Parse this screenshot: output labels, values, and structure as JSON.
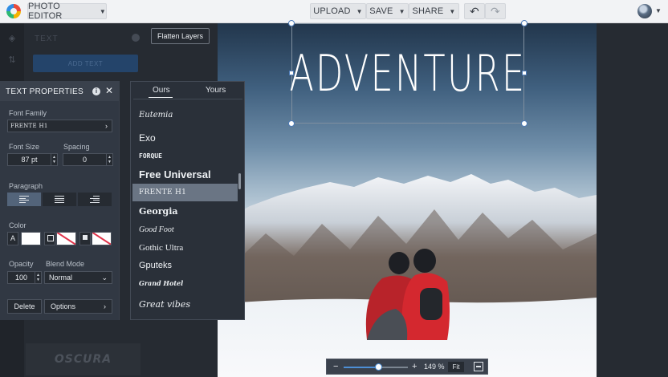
{
  "app": {
    "menu_label": "PHOTO EDITOR",
    "icon": "app-logo-icon"
  },
  "toolbar": {
    "upload_label": "UPLOAD",
    "save_label": "SAVE",
    "share_label": "SHARE",
    "undo_icon": "undo-icon",
    "redo_icon": "redo-icon"
  },
  "background_panel": {
    "title": "TEXT",
    "add_text_label": "ADD TEXT",
    "preview_font_label": "OSCURA"
  },
  "flatten_label": "Flatten Layers",
  "text_properties": {
    "title": "TEXT PROPERTIES",
    "font_family_label": "Font Family",
    "font_family_value": "FRENTE H1",
    "font_size_label": "Font Size",
    "font_size_value": "87 pt",
    "spacing_label": "Spacing",
    "spacing_value": "0",
    "paragraph_label": "Paragraph",
    "paragraph_selected": "left",
    "color_label": "Color",
    "text_color_label": "A",
    "text_color": "#ffffff",
    "opacity_label": "Opacity",
    "opacity_value": "100",
    "blend_label": "Blend Mode",
    "blend_value": "Normal",
    "delete_label": "Delete",
    "options_label": "Options"
  },
  "font_picker": {
    "tabs": [
      "Ours",
      "Yours"
    ],
    "active_tab": "Ours",
    "fonts": [
      {
        "name": "Eutemia",
        "selected": false
      },
      {
        "name": "Exo",
        "selected": false
      },
      {
        "name": "FORQUE",
        "selected": false
      },
      {
        "name": "Free Universal",
        "selected": false
      },
      {
        "name": "FRENTE H1",
        "selected": true
      },
      {
        "name": "Georgia",
        "selected": false
      },
      {
        "name": "Good Foot",
        "selected": false
      },
      {
        "name": "Gothic Ultra",
        "selected": false
      },
      {
        "name": "Gputeks",
        "selected": false
      },
      {
        "name": "Grand Hotel",
        "selected": false
      },
      {
        "name": "Great vibes",
        "selected": false
      }
    ]
  },
  "canvas": {
    "headline": "ADVENTURE",
    "zoom_level": "149 %",
    "zoom_slider_value": 0.55,
    "fit_label": "Fit"
  }
}
